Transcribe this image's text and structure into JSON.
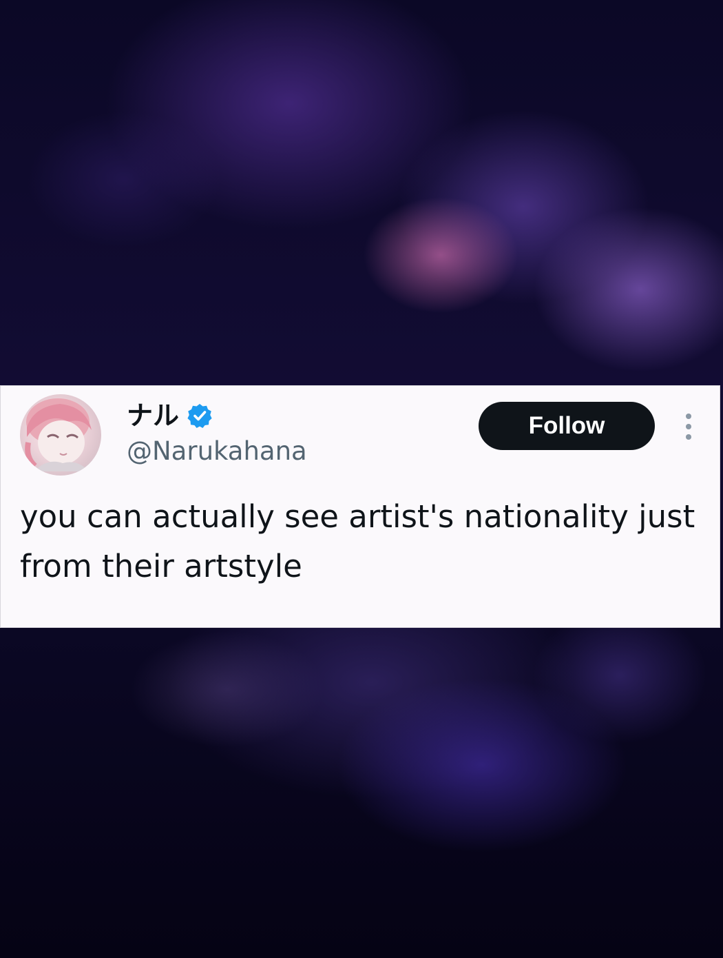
{
  "tweet": {
    "display_name": "ナル",
    "handle": "@Narukahana",
    "follow_label": "Follow",
    "text": "you can actually see artist's nationality just from their artstyle",
    "avatar_icon": "profile-avatar",
    "verified_icon": "verified-badge-icon",
    "more_icon": "more-options-icon"
  },
  "colors": {
    "verified": "#1d9bf0",
    "follow_bg": "#0f1419",
    "text": "#0f1419",
    "handle": "#536471",
    "card_bg": "#fbf9fc"
  }
}
